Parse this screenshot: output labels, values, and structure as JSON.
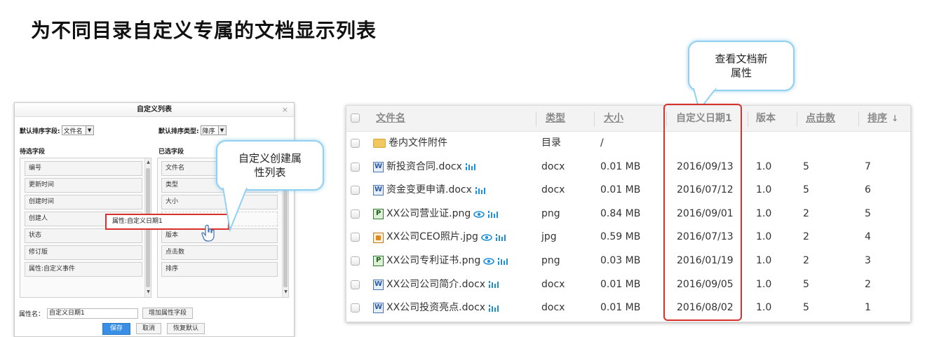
{
  "slide": {
    "title": "为不同目录自定义专属的文档显示列表"
  },
  "dialog": {
    "title": "自定义列表",
    "close_glyph": "×",
    "default_sort_field_label": "默认排序字段:",
    "default_sort_field_value": "文件名",
    "default_sort_type_label": "默认排序类型:",
    "default_sort_type_value": "降序",
    "available_heading": "待选字段",
    "selected_heading": "已选字段",
    "available_fields": [
      "编号",
      "更新时间",
      "创建时间",
      "创建人",
      "状态",
      "修订版",
      "属性:自定义事件"
    ],
    "selected_fields": [
      "文件名",
      "类型",
      "大小",
      "",
      "版本",
      "点击数",
      "排序"
    ],
    "attr_name_label": "属性名：",
    "attr_name_value": "自定义日期1",
    "add_attr_button": "增加属性字段",
    "save_button": "保存",
    "cancel_button": "取消",
    "restore_button": "恢复默认",
    "dragging_item": "属性:自定义日期1"
  },
  "callouts": {
    "create": "自定义创建属\n性列表",
    "view": "查看文档新\n属性"
  },
  "file_table": {
    "headers": {
      "name": "文件名",
      "type": "类型",
      "size": "大小",
      "custom_date": "自定义日期1",
      "version": "版本",
      "clicks": "点击数",
      "order": "排序",
      "order_arrow": "↓"
    },
    "rows": [
      {
        "icon": "folder-icon",
        "name": "卷内文件附件",
        "type": "目录",
        "size": "/",
        "date": "",
        "version": "",
        "clicks": "",
        "order": "",
        "preview": false
      },
      {
        "icon": "word-doc-icon",
        "name": "新投资合同.docx",
        "type": "docx",
        "size": "0.01 MB",
        "date": "2016/09/13",
        "version": "1.0",
        "clicks": "5",
        "order": "7",
        "preview": false
      },
      {
        "icon": "word-doc-icon",
        "name": "资金变更申请.docx",
        "type": "docx",
        "size": "0.01 MB",
        "date": "2016/07/12",
        "version": "1.0",
        "clicks": "5",
        "order": "6",
        "preview": false
      },
      {
        "icon": "png-image-icon",
        "name": "XX公司营业证.png",
        "type": "png",
        "size": "0.84 MB",
        "date": "2016/09/01",
        "version": "1.0",
        "clicks": "2",
        "order": "5",
        "preview": true
      },
      {
        "icon": "jpg-image-icon",
        "name": "XX公司CEO照片.jpg",
        "type": "jpg",
        "size": "0.59 MB",
        "date": "2016/07/13",
        "version": "1.0",
        "clicks": "2",
        "order": "4",
        "preview": true
      },
      {
        "icon": "png-image-icon",
        "name": "XX公司专利证书.png",
        "type": "png",
        "size": "0.03 MB",
        "date": "2016/01/19",
        "version": "1.0",
        "clicks": "2",
        "order": "3",
        "preview": true
      },
      {
        "icon": "word-doc-icon",
        "name": "XX公司公司简介.docx",
        "type": "docx",
        "size": "0.01 MB",
        "date": "2016/09/05",
        "version": "1.0",
        "clicks": "5",
        "order": "2",
        "preview": false
      },
      {
        "icon": "word-doc-icon",
        "name": "XX公司投资亮点.docx",
        "type": "docx",
        "size": "0.01 MB",
        "date": "2016/08/02",
        "version": "1.0",
        "clicks": "5",
        "order": "1",
        "preview": false
      }
    ]
  },
  "colors": {
    "highlight_red": "#d9302a",
    "callout_border": "#8fd0f3",
    "primary_blue": "#3a8ee6",
    "stats_icon_blue": "#1e90d8"
  }
}
